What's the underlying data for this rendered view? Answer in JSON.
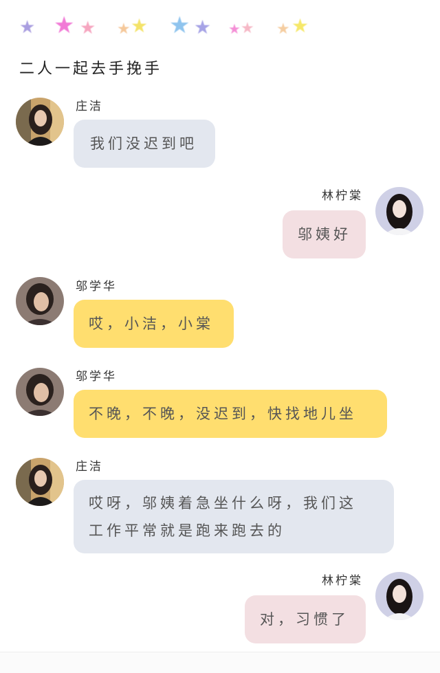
{
  "header": {
    "title": "二人一起去手挽手",
    "stars": [
      {
        "icon": "star-icon",
        "color": "#a99ee0"
      },
      {
        "icon": "star-icon",
        "color": "#f17ad6"
      },
      {
        "icon": "star-icon",
        "color": "#f6a6c0"
      },
      {
        "icon": "star-icon",
        "color": "#f5c89a"
      },
      {
        "icon": "star-icon",
        "color": "#f4e36a"
      },
      {
        "icon": "star-icon",
        "color": "#8fc4ee"
      },
      {
        "icon": "star-icon",
        "color": "#a6a3e6"
      },
      {
        "icon": "star-icon",
        "color": "#f48ed6"
      },
      {
        "icon": "star-icon",
        "color": "#f6b8c6"
      },
      {
        "icon": "star-icon",
        "color": "#f5cda0"
      },
      {
        "icon": "star-icon",
        "color": "#f6e86a"
      }
    ]
  },
  "colors": {
    "bubble_blue": "#e3e7ef",
    "bubble_pink": "#f3dfe2",
    "bubble_yellow": "#ffde6f"
  },
  "messages": [
    {
      "sender": "庄洁",
      "side": "left",
      "color": "blue",
      "text": "我们没迟到吧"
    },
    {
      "sender": "林柠棠",
      "side": "right",
      "color": "pink",
      "text": "邬姨好"
    },
    {
      "sender": "邬学华",
      "side": "left",
      "color": "yellow",
      "text": "哎，小洁，小棠"
    },
    {
      "sender": "邬学华",
      "side": "left",
      "color": "yellow",
      "text": "不晚，不晚，没迟到，快找地儿坐"
    },
    {
      "sender": "庄洁",
      "side": "left",
      "color": "blue",
      "text_line1": "哎呀，邬姨着急坐什么呀，我们这",
      "text_line2": "工作平常就是跑来跑去的"
    },
    {
      "sender": "林柠棠",
      "side": "right",
      "color": "pink",
      "text": "对，习惯了"
    }
  ]
}
